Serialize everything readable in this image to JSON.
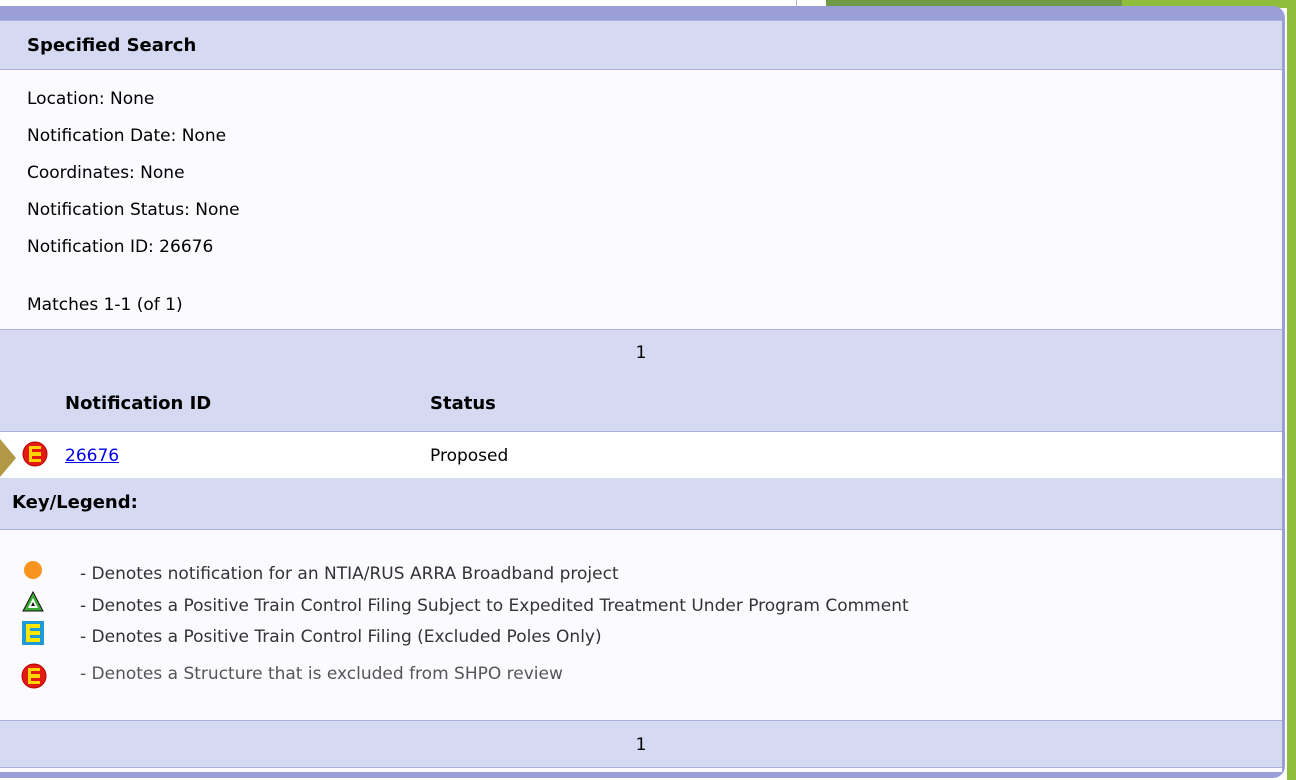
{
  "header": {
    "title": "Specified Search"
  },
  "search_criteria": [
    "Location: None",
    "Notification Date: None",
    "Coordinates: None",
    "Notification Status: None",
    "Notification ID: 26676"
  ],
  "matches": "Matches 1-1 (of 1)",
  "pagination": {
    "top": "1",
    "bottom": "1"
  },
  "table": {
    "columns": [
      "Notification ID",
      "Status"
    ],
    "rows": [
      {
        "id": "26676",
        "status": "Proposed",
        "icon": "excluded-structure-icon"
      }
    ]
  },
  "legend": {
    "title": "Key/Legend:",
    "items": [
      {
        "icon": "orange-circle-icon",
        "text": "- Denotes notification for an NTIA/RUS ARRA Broadband project"
      },
      {
        "icon": "ptc-triangle-icon",
        "text": "- Denotes a Positive Train Control Filing Subject to Expedited Treatment Under Program Comment"
      },
      {
        "icon": "ptc-excluded-poles-icon",
        "text": "- Denotes a Positive Train Control Filing (Excluded Poles Only)"
      },
      {
        "icon": "excluded-structure-icon",
        "text": "- Denotes a Structure that is excluded from SHPO review"
      }
    ]
  },
  "colors": {
    "panel_border": "#9b9fd8",
    "band": "#d6d9f2",
    "link": "#0000ee"
  }
}
